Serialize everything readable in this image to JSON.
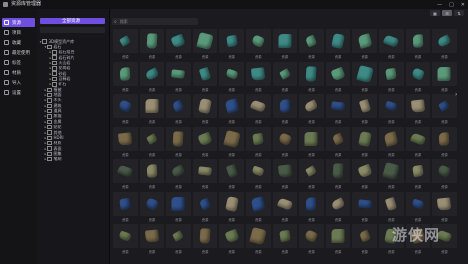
{
  "window": {
    "title": "资源库管理器",
    "controls": [
      "—",
      "□",
      "✕"
    ],
    "icon": "app-icon"
  },
  "nav": {
    "items": [
      {
        "label": "资源",
        "active": true,
        "icon": "cube-icon"
      },
      {
        "label": "项目",
        "active": false,
        "icon": "folder-icon"
      },
      {
        "label": "收藏",
        "active": false,
        "icon": "star-icon"
      },
      {
        "label": "最近使用",
        "active": false,
        "icon": "clock-icon"
      },
      {
        "label": "标签",
        "active": false,
        "icon": "tag-icon"
      },
      {
        "label": "材质",
        "active": false,
        "icon": "layers-icon"
      },
      {
        "label": "导入",
        "active": false,
        "icon": "import-icon"
      },
      {
        "label": "设置",
        "active": false,
        "icon": "gear-icon"
      }
    ]
  },
  "tree": {
    "button_label": "全部资源",
    "items": [
      {
        "label": "3D模型资产库",
        "depth": 0,
        "arrow": "▾"
      },
      {
        "label": "岩石",
        "depth": 1,
        "arrow": "▾"
      },
      {
        "label": "岩石组合",
        "depth": 2,
        "arrow": "▸"
      },
      {
        "label": "岩石碎片",
        "depth": 2,
        "arrow": "▸"
      },
      {
        "label": "火山岩",
        "depth": 2,
        "arrow": "▸"
      },
      {
        "label": "花岗岩",
        "depth": 2,
        "arrow": "▸"
      },
      {
        "label": "砂岩",
        "depth": 2,
        "arrow": "▸"
      },
      {
        "label": "苔藓岩",
        "depth": 2,
        "arrow": "▸"
      },
      {
        "label": "矿石",
        "depth": 2,
        "arrow": "▸"
      },
      {
        "label": "植被",
        "depth": 1,
        "arrow": "▸"
      },
      {
        "label": "地面",
        "depth": 1,
        "arrow": "▸"
      },
      {
        "label": "木头",
        "depth": 1,
        "arrow": "▸"
      },
      {
        "label": "建筑",
        "depth": 1,
        "arrow": "▸"
      },
      {
        "label": "道具",
        "depth": 1,
        "arrow": "▸"
      },
      {
        "label": "废墟",
        "depth": 1,
        "arrow": "▸"
      },
      {
        "label": "金属",
        "depth": 1,
        "arrow": "▸"
      },
      {
        "label": "贴花",
        "depth": 1,
        "arrow": "▸"
      },
      {
        "label": "其他",
        "depth": 1,
        "arrow": "▸"
      },
      {
        "label": "HDRI",
        "depth": 1,
        "arrow": "▸"
      },
      {
        "label": "材质",
        "depth": 1,
        "arrow": "▸"
      },
      {
        "label": "表面",
        "depth": 1,
        "arrow": "▸"
      },
      {
        "label": "图集",
        "depth": 1,
        "arrow": "▸"
      },
      {
        "label": "笔刷",
        "depth": 1,
        "arrow": "▸"
      }
    ]
  },
  "main": {
    "search_icon": "search-icon",
    "search_placeholder": "搜索",
    "tool_buttons": [
      {
        "label": "▦",
        "active": false
      },
      {
        "label": "☰",
        "active": true
      },
      {
        "label": "⇅",
        "active": false
      }
    ]
  },
  "asset_palette": [
    "#3d8a86",
    "#5a9a7a",
    "#6a7a52",
    "#8a8a68",
    "#2f4f8a",
    "#7a6a4a",
    "#4a5a48",
    "#9a8e74"
  ],
  "asset_label": "资源",
  "asset_rows": 7,
  "asset_cols": 13,
  "scroll_indicator": "›",
  "watermark": "游侠网"
}
